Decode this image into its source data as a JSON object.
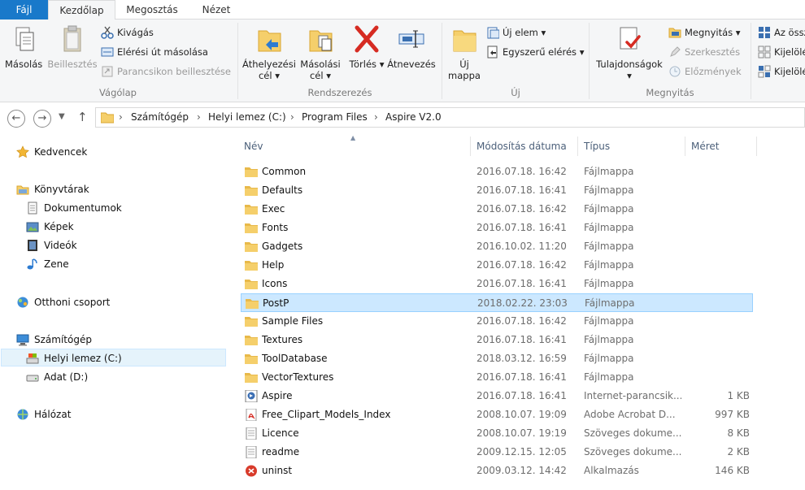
{
  "ribbon_tabs": [
    "Fájl",
    "Kezdőlap",
    "Megosztás",
    "Nézet"
  ],
  "ribbon": {
    "clipboard": {
      "label": "Vágólap",
      "copy": "Másolás",
      "paste": "Beillesztés",
      "cut": "Kivágás",
      "copy_path": "Elérési út másolása",
      "paste_shortcut": "Parancsikon beillesztése"
    },
    "organize": {
      "label": "Rendszerezés",
      "move_to_1": "Áthelyezési",
      "move_to_2": "cél",
      "copy_to_1": "Másolási",
      "copy_to_2": "cél",
      "delete": "Törlés",
      "rename": "Átnevezés"
    },
    "new": {
      "label": "Új",
      "new_folder_1": "Új",
      "new_folder_2": "mappa",
      "new_item": "Új elem",
      "easy_access": "Egyszerű elérés"
    },
    "open": {
      "label": "Megnyitás",
      "properties": "Tulajdonságok",
      "open": "Megnyitás",
      "edit": "Szerkesztés",
      "history": "Előzmények"
    },
    "select": {
      "select_all": "Az össz",
      "select_none": "Kijelölé",
      "invert": "Kijelölé"
    }
  },
  "address": {
    "crumbs": [
      "Számítógép",
      "Helyi lemez (C:)",
      "Program Files",
      "Aspire V2.0"
    ]
  },
  "sidebar": {
    "favorites": "Kedvencek",
    "libraries": "Könyvtárak",
    "documents": "Dokumentumok",
    "pictures": "Képek",
    "videos": "Videók",
    "music": "Zene",
    "homegroup": "Otthoni csoport",
    "computer": "Számítógép",
    "local_disk": "Helyi lemez (C:)",
    "data_disk": "Adat (D:)",
    "network": "Hálózat"
  },
  "columns": {
    "name": "Név",
    "date": "Módosítás dátuma",
    "type": "Típus",
    "size": "Méret"
  },
  "files": [
    {
      "name": "Common",
      "date": "2016.07.18. 16:42",
      "type": "Fájlmappa",
      "size": "",
      "icon": "folder-icon"
    },
    {
      "name": "Defaults",
      "date": "2016.07.18. 16:41",
      "type": "Fájlmappa",
      "size": "",
      "icon": "folder-icon"
    },
    {
      "name": "Exec",
      "date": "2016.07.18. 16:42",
      "type": "Fájlmappa",
      "size": "",
      "icon": "folder-icon"
    },
    {
      "name": "Fonts",
      "date": "2016.07.18. 16:41",
      "type": "Fájlmappa",
      "size": "",
      "icon": "folder-icon"
    },
    {
      "name": "Gadgets",
      "date": "2016.10.02. 11:20",
      "type": "Fájlmappa",
      "size": "",
      "icon": "folder-icon"
    },
    {
      "name": "Help",
      "date": "2016.07.18. 16:42",
      "type": "Fájlmappa",
      "size": "",
      "icon": "folder-icon"
    },
    {
      "name": "Icons",
      "date": "2016.07.18. 16:41",
      "type": "Fájlmappa",
      "size": "",
      "icon": "folder-icon"
    },
    {
      "name": "PostP",
      "date": "2018.02.22. 23:03",
      "type": "Fájlmappa",
      "size": "",
      "icon": "folder-icon"
    },
    {
      "name": "Sample Files",
      "date": "2016.07.18. 16:42",
      "type": "Fájlmappa",
      "size": "",
      "icon": "folder-icon"
    },
    {
      "name": "Textures",
      "date": "2016.07.18. 16:41",
      "type": "Fájlmappa",
      "size": "",
      "icon": "folder-icon"
    },
    {
      "name": "ToolDatabase",
      "date": "2018.03.12. 16:59",
      "type": "Fájlmappa",
      "size": "",
      "icon": "folder-icon"
    },
    {
      "name": "VectorTextures",
      "date": "2016.07.18. 16:41",
      "type": "Fájlmappa",
      "size": "",
      "icon": "folder-icon"
    },
    {
      "name": "Aspire",
      "date": "2016.07.18. 16:41",
      "type": "Internet-parancsik...",
      "size": "1 KB",
      "icon": "shortcut-icon"
    },
    {
      "name": "Free_Clipart_Models_Index",
      "date": "2008.10.07. 19:09",
      "type": "Adobe Acrobat D...",
      "size": "997 KB",
      "icon": "pdf-icon"
    },
    {
      "name": "Licence",
      "date": "2008.10.07. 19:19",
      "type": "Szöveges dokume...",
      "size": "8 KB",
      "icon": "text-file-icon"
    },
    {
      "name": "readme",
      "date": "2009.12.15. 12:05",
      "type": "Szöveges dokume...",
      "size": "2 KB",
      "icon": "text-file-icon"
    },
    {
      "name": "uninst",
      "date": "2009.03.12. 14:42",
      "type": "Alkalmazás",
      "size": "146 KB",
      "icon": "app-icon"
    }
  ],
  "selected_file": "PostP",
  "colors": {
    "accent": "#1979ca",
    "selection": "#cce8ff",
    "folder": "#f5cf6b"
  }
}
